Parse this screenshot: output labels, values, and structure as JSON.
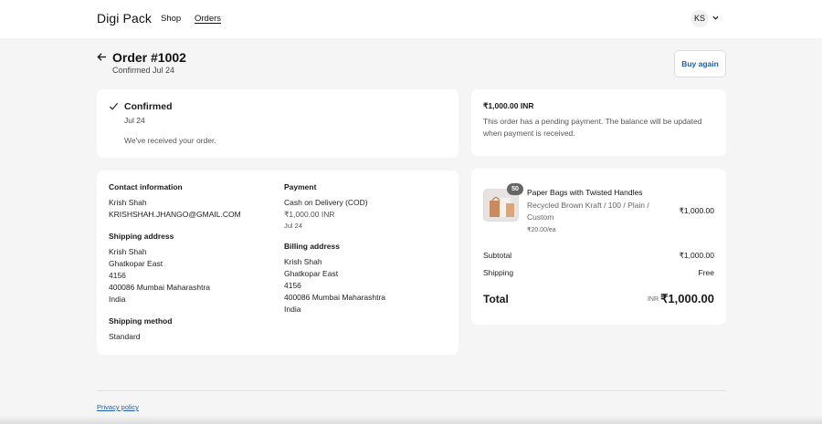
{
  "header": {
    "brand": "Digi Pack",
    "nav": {
      "shop": "Shop",
      "orders": "Orders"
    },
    "user_initials": "KS"
  },
  "order": {
    "title": "Order #1002",
    "subtitle": "Confirmed Jul 24",
    "buy_again_label": "Buy again"
  },
  "status": {
    "title": "Confirmed",
    "date": "Jul 24",
    "message": "We've received your order."
  },
  "balance": {
    "amount": "₹1,000.00 INR",
    "message": "This order has a pending payment. The balance will be updated when payment is received."
  },
  "details": {
    "contact_heading": "Contact information",
    "contact_name": "Krish Shah",
    "contact_email": "KRISHSHAH.JHANGO@GMAIL.COM",
    "payment_heading": "Payment",
    "payment_method": "Cash on Delivery (COD)",
    "payment_amount": "₹1,000.00 INR",
    "payment_date": "Jul 24",
    "shipping_heading": "Shipping address",
    "shipping_lines": [
      "Krish Shah",
      "Ghatkopar East",
      "4156",
      "400086 Mumbai Maharashtra",
      "India"
    ],
    "billing_heading": "Billing address",
    "billing_lines": [
      "Krish Shah",
      "Ghatkopar East",
      "4156",
      "400086 Mumbai Maharashtra",
      "India"
    ],
    "method_heading": "Shipping method",
    "method_value": "Standard"
  },
  "summary": {
    "product": {
      "quantity": "50",
      "name": "Paper Bags with Twisted Handles",
      "variant": "Recycled Brown Kraft / 100 / Plain / Custom",
      "unit_price": "₹20.00/ea",
      "price": "₹1,000.00"
    },
    "subtotal_label": "Subtotal",
    "subtotal_value": "₹1,000.00",
    "shipping_label": "Shipping",
    "shipping_value": "Free",
    "total_label": "Total",
    "total_currency": "INR",
    "total_value": "₹1,000.00"
  },
  "footer": {
    "privacy_label": "Privacy policy"
  },
  "colors": {
    "accent": "#1f5fb0",
    "background": "#f5f5f5",
    "card": "#ffffff"
  },
  "icons": [
    "back-arrow-icon",
    "chevron-down-icon",
    "checkmark-icon"
  ]
}
